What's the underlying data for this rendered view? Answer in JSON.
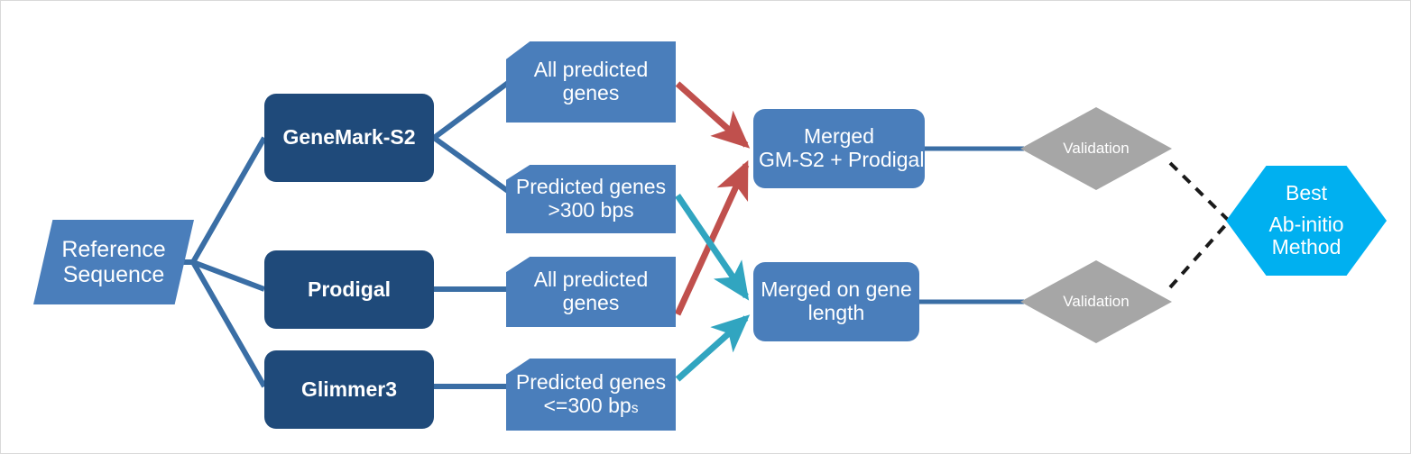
{
  "diagram": {
    "title": "Ab-initio gene prediction pipeline flowchart",
    "colors": {
      "light_blue": "#4a7ebb",
      "dark_navy": "#1f4a7a",
      "gray": "#a6a6a6",
      "cyan": "#00b0f0",
      "red_arrow": "#c0504d",
      "teal_arrow": "#31a5c0",
      "connector_blue": "#3a6ea5",
      "dashed_line": "#1a1a1a",
      "text_white": "#ffffff",
      "canvas": "#ffffff"
    },
    "nodes": {
      "reference_sequence": {
        "line1": "Reference",
        "line2": "Sequence",
        "shape": "parallelogram"
      },
      "genemark": {
        "label": "GeneMark-S2",
        "shape": "rounded-rectangle"
      },
      "prodigal": {
        "label": "Prodigal",
        "shape": "rounded-rectangle"
      },
      "glimmer": {
        "label": "Glimmer3",
        "shape": "rounded-rectangle"
      },
      "gm_all_genes": {
        "line1": "All predicted",
        "line2": "genes",
        "shape": "pentagon"
      },
      "gm_large_genes": {
        "line1": "Predicted genes",
        "line2": ">300 bps",
        "shape": "pentagon"
      },
      "prodigal_all_genes": {
        "line1": "All predicted",
        "line2": "genes",
        "shape": "pentagon"
      },
      "glimmer_small_genes": {
        "line1": "Predicted genes",
        "line2_main": "<=300 bp",
        "line2_sub": "s",
        "shape": "pentagon"
      },
      "merged_gm_prodigal": {
        "line1": "Merged",
        "line2": "GM-S2 + Prodigal",
        "shape": "rounded-rectangle"
      },
      "merged_gene_length": {
        "line1": "Merged on gene",
        "line2": "length",
        "shape": "rounded-rectangle"
      },
      "validation_top": {
        "label": "Validation",
        "shape": "diamond"
      },
      "validation_bottom": {
        "label": "Validation",
        "shape": "diamond"
      },
      "best_method": {
        "line1": "Best",
        "line2": "Ab-initio",
        "line3": "Method",
        "shape": "hexagon"
      }
    }
  }
}
